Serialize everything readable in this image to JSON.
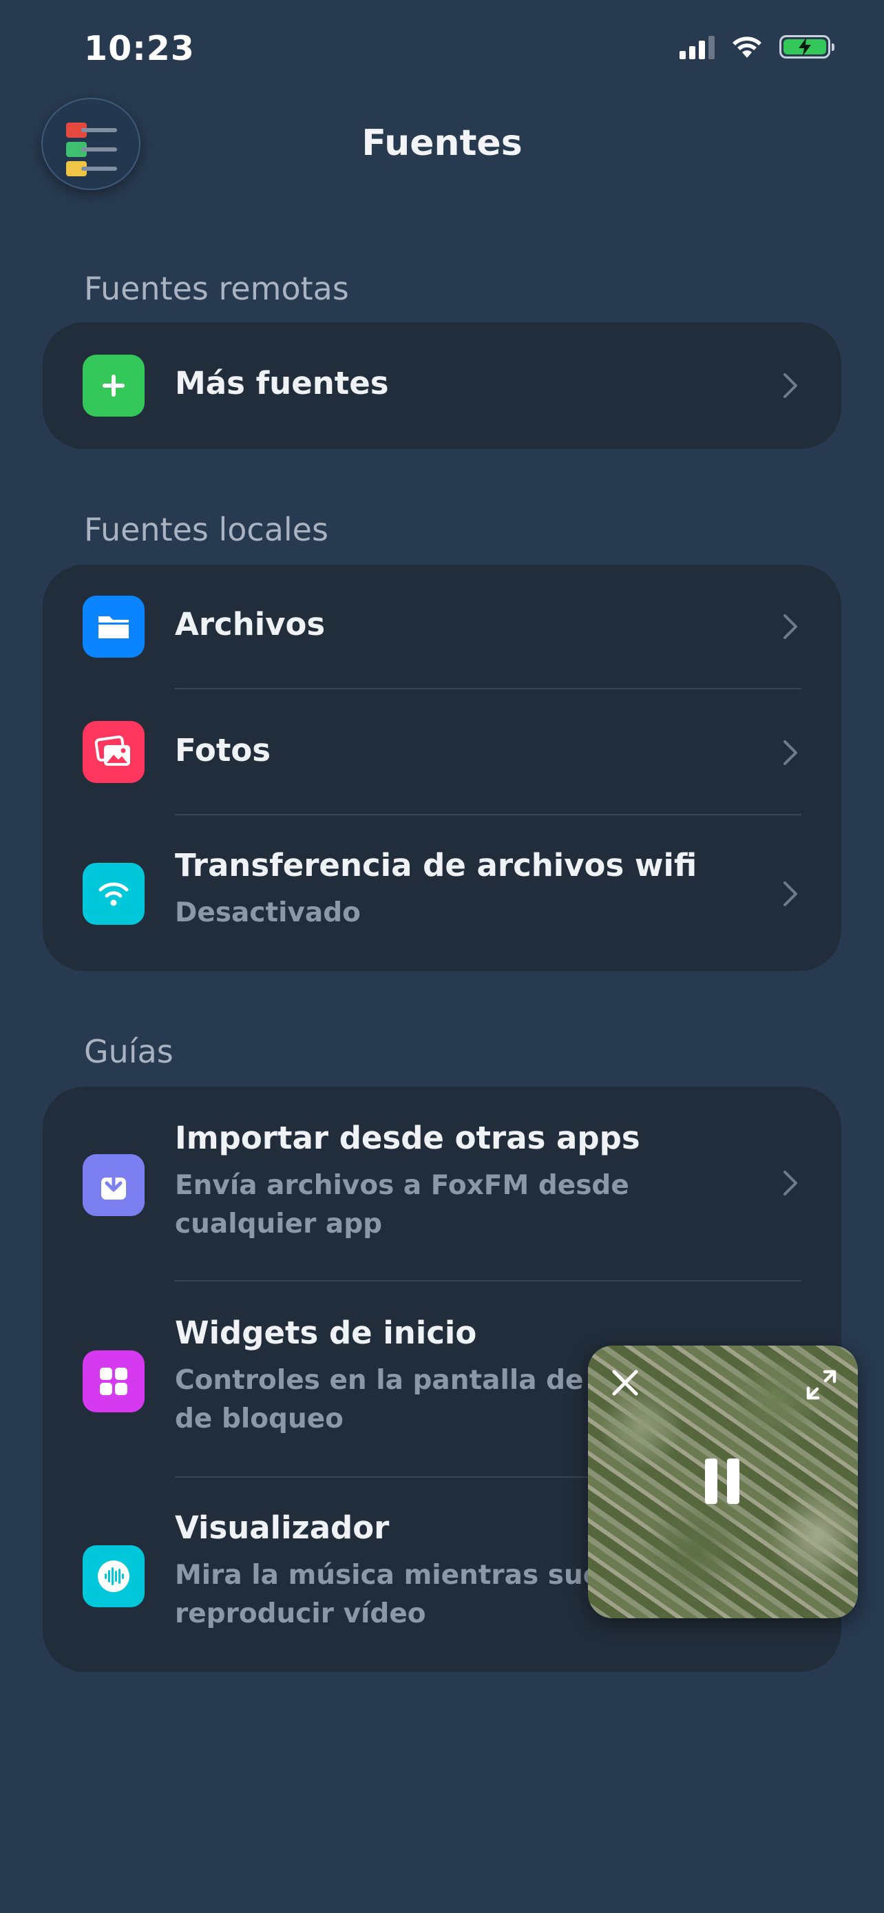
{
  "status_bar": {
    "time": "10:23"
  },
  "header": {
    "title": "Fuentes"
  },
  "sections": {
    "remote": {
      "label": "Fuentes remotas",
      "items": [
        {
          "title": "Más fuentes",
          "icon": "plus-icon",
          "color": "#34c759"
        }
      ]
    },
    "local": {
      "label": "Fuentes locales",
      "items": [
        {
          "title": "Archivos",
          "icon": "folder-icon",
          "color": "#0a84ff"
        },
        {
          "title": "Fotos",
          "icon": "photos-icon",
          "color": "#ff375f"
        },
        {
          "title": "Transferencia de archivos wifi",
          "subtitle": "Desactivado",
          "icon": "wifi-icon",
          "color": "#00c7d9"
        }
      ]
    },
    "guides": {
      "label": "Guías",
      "items": [
        {
          "title": "Importar desde otras apps",
          "subtitle_1": "Envía archivos a FoxFM desde",
          "subtitle_2": "cualquier app",
          "icon": "import-icon",
          "color": "#7b7ff0"
        },
        {
          "title": "Widgets de inicio",
          "subtitle_1": "Controles en la pantalla de inic",
          "subtitle_2": "de bloqueo",
          "icon": "widgets-icon",
          "color": "#d63af0"
        },
        {
          "title": "Visualizador",
          "subtitle_1": "Mira la música mientras suena",
          "subtitle_2": "reproducir vídeo",
          "icon": "waveform-icon",
          "color": "#00c7d9"
        }
      ]
    }
  },
  "pip_player": {
    "state": "playing"
  }
}
